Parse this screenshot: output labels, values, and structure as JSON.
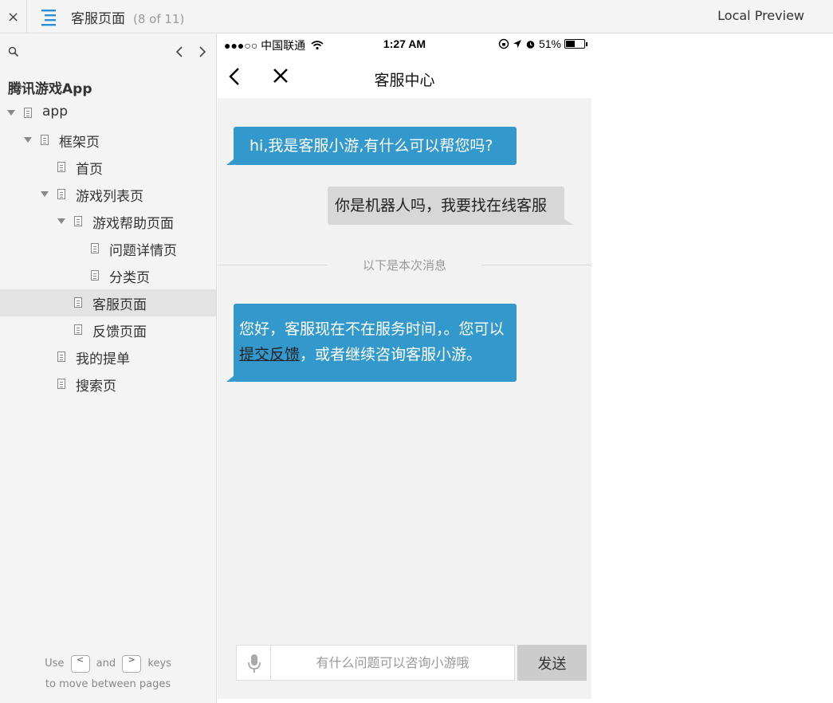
{
  "topbar": {
    "close_label": "×",
    "page_title": "客服页面",
    "page_count": "(8 of 11)",
    "local_preview": "Local Preview"
  },
  "sidebar": {
    "project_name": "腾讯游戏App",
    "tree": [
      {
        "label": "app",
        "expanded": true
      },
      {
        "label": "框架页",
        "expanded": true
      },
      {
        "label": "首页"
      },
      {
        "label": "游戏列表页",
        "expanded": true
      },
      {
        "label": "游戏帮助页面",
        "expanded": true
      },
      {
        "label": "问题详情页"
      },
      {
        "label": "分类页"
      },
      {
        "label": "客服页面",
        "active": true
      },
      {
        "label": "反馈页面"
      },
      {
        "label": "我的提单"
      },
      {
        "label": "搜索页"
      }
    ],
    "help": {
      "use": "Use",
      "key_prev": "<",
      "and": "and",
      "key_next": ">",
      "keys": "keys",
      "line2": "to move between pages"
    }
  },
  "phone": {
    "status": {
      "carrier": "●●●○○ 中国联通",
      "time": "1:27 AM",
      "battery": "51%",
      "battery_level": 0.51
    },
    "nav": {
      "title": "客服中心"
    },
    "messages": {
      "m1": "hi,我是客服小游,有什么可以帮您吗?",
      "m2": "你是机器人吗，我要找在线客服",
      "m3_part1": "您好，客服现在不在服务时间，。您可以",
      "m3_link": "提交反馈",
      "m3_part2": "，或者继续咨询客服小游。"
    },
    "divider": "以下是本次消息",
    "input": {
      "placeholder": "有什么问题可以咨询小游哦",
      "send": "发送"
    }
  },
  "colors": {
    "accent": "#3399cc",
    "user_bubble": "#d7d7d7",
    "menu_icon": "#2a8fd8"
  }
}
